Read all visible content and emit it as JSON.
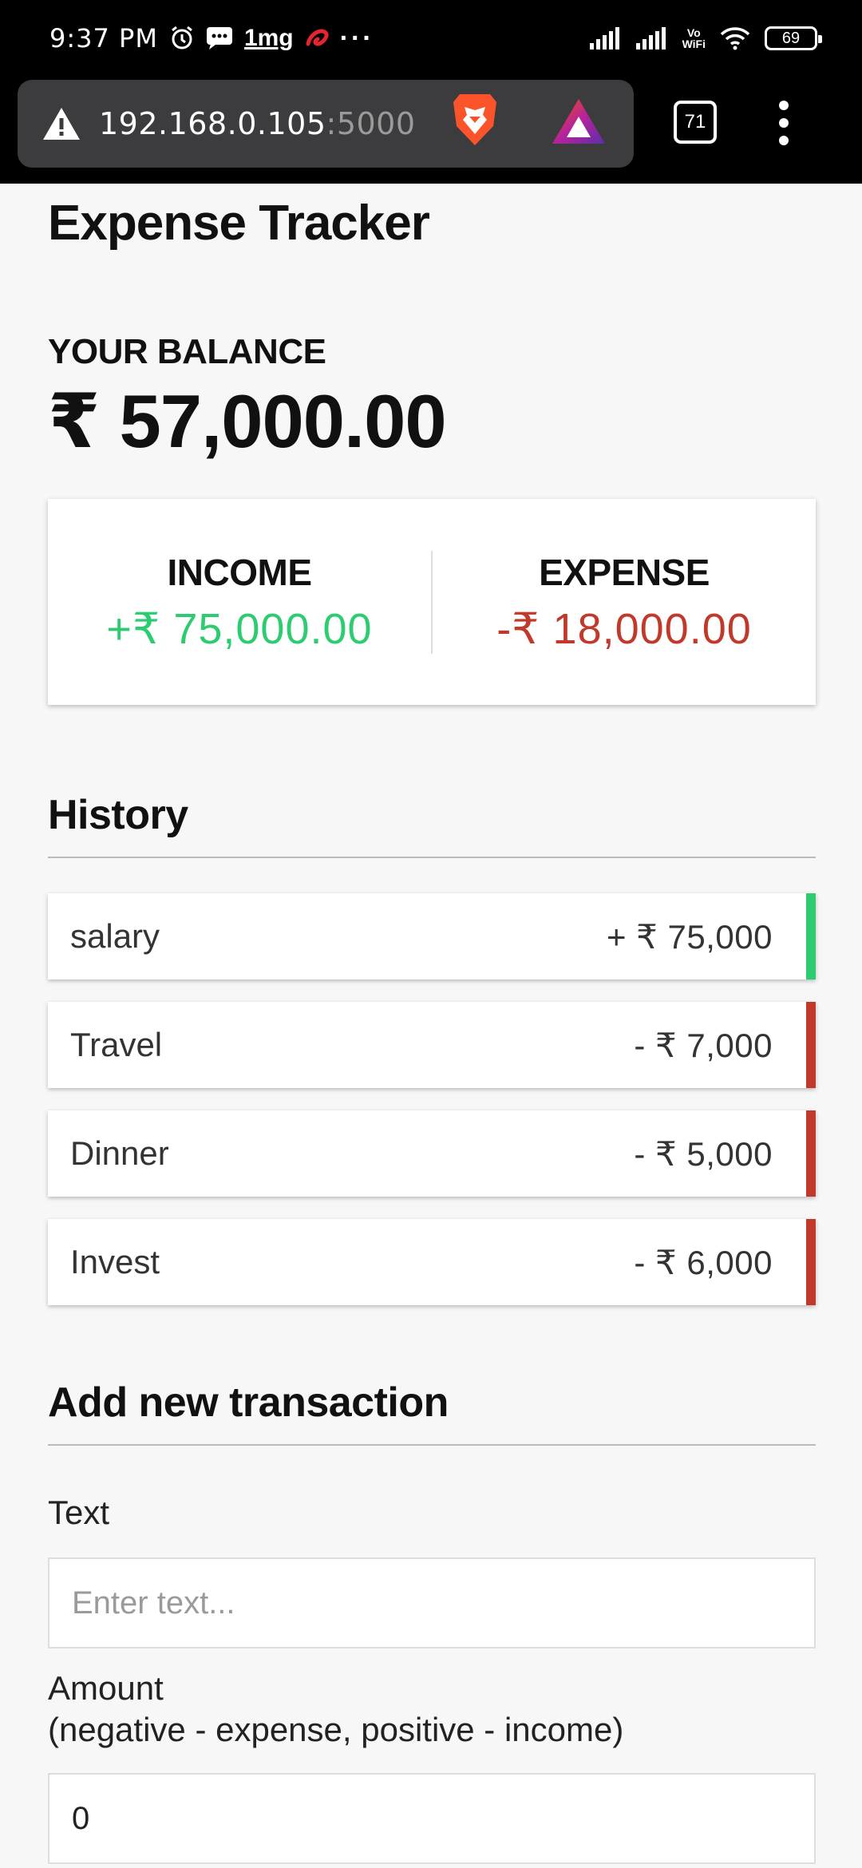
{
  "status_bar": {
    "time": "9:37 PM",
    "notification_icons": [
      "alarm-icon",
      "message-icon"
    ],
    "brand_label": "1mg",
    "overflow": "···",
    "vowifi_top": "Vo",
    "vowifi_bottom": "WiFi",
    "battery": "69"
  },
  "browser": {
    "url_host": "192.168.0.105",
    "url_port": ":5000",
    "tab_count": "71"
  },
  "app": {
    "title": "Expense Tracker",
    "balance_label": "YOUR BALANCE",
    "balance_value": "₹ 57,000.00",
    "income_label": "INCOME",
    "income_value": "+₹ 75,000.00",
    "expense_label": "EXPENSE",
    "expense_value": "-₹ 18,000.00",
    "history_title": "History",
    "history": [
      {
        "text": "salary",
        "amount": "+ ₹ 75,000",
        "type": "plus"
      },
      {
        "text": "Travel",
        "amount": "- ₹ 7,000",
        "type": "minus"
      },
      {
        "text": "Dinner",
        "amount": "- ₹ 5,000",
        "type": "minus"
      },
      {
        "text": "Invest",
        "amount": "- ₹ 6,000",
        "type": "minus"
      }
    ],
    "add_title": "Add new transaction",
    "text_label": "Text",
    "text_placeholder": "Enter text...",
    "amount_label_line1": "Amount",
    "amount_label_line2": "(negative - expense, positive - income)",
    "amount_value": "0"
  },
  "colors": {
    "income": "#2ecc71",
    "expense": "#c0392b",
    "background": "#f7f7f7"
  }
}
